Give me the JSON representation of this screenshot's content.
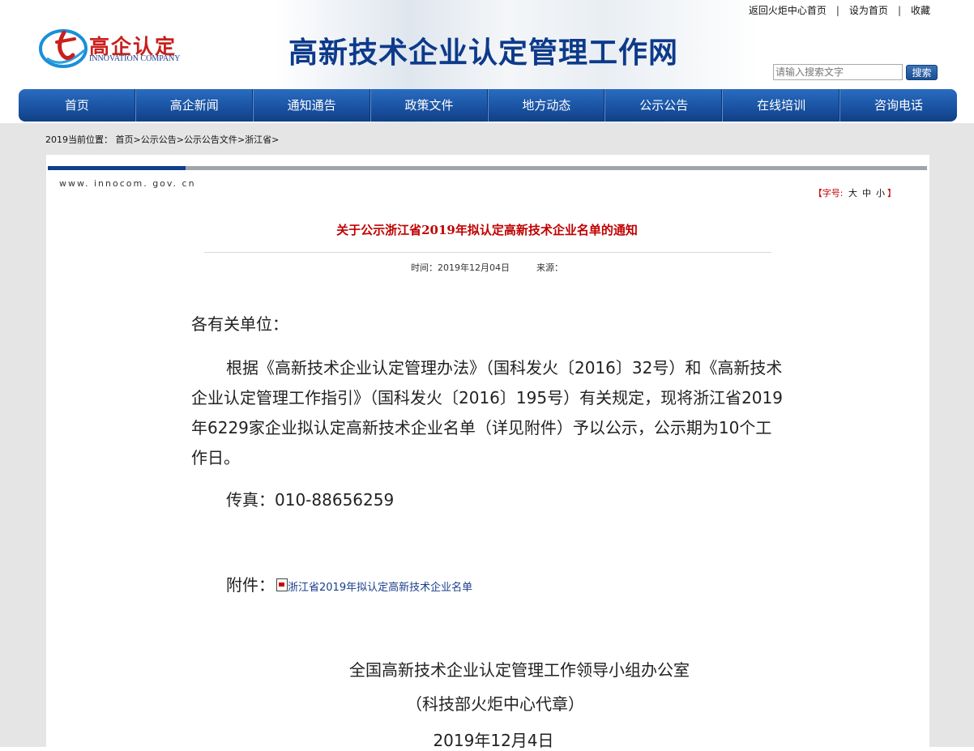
{
  "top_links": {
    "home": "返回火炬中心首页",
    "set_home": "设为首页",
    "bookmark": "收藏",
    "separator": "|"
  },
  "logo": {
    "title": "高企认定",
    "subtitle": "INNOVATION COMPANY",
    "icon": "torch-swirl-logo",
    "colors": {
      "red": "#c8201c",
      "blue": "#1a3e8c"
    }
  },
  "site_title": "高新技术企业认定管理工作网",
  "search": {
    "placeholder": "请输入搜索文字",
    "button": "搜索"
  },
  "nav": [
    "首页",
    "高企新闻",
    "通知通告",
    "政策文件",
    "地方动态",
    "公示公告",
    "在线培训",
    "咨询电话"
  ],
  "breadcrumb": {
    "prefix": "2019当前位置：",
    "items": [
      "首页",
      "公示公告",
      "公示公告文件",
      "浙江省"
    ],
    "sep": ">"
  },
  "site_url": "www. innocom. gov. cn",
  "font_size": {
    "label": "【字号:",
    "large": "大",
    "medium": "中",
    "small": "小",
    "close": "】"
  },
  "article": {
    "title": "关于公示浙江省2019年拟认定高新技术企业名单的通知",
    "time_label": "时间：",
    "time": "2019年12月04日",
    "source_label": "来源：",
    "salutation": "各有关单位：",
    "paragraph": "根据《高新技术企业认定管理办法》（国科发火〔2016〕32号）和《高新技术企业认定管理工作指引》（国科发火〔2016〕195号）有关规定，现将浙江省2019年6229家企业拟认定高新技术企业名单（详见附件）予以公示，公示期为10个工作日。",
    "fax": "传真：010-88656259",
    "attachment_label": "附件：",
    "attachment_link": "浙江省2019年拟认定高新技术企业名单",
    "signature_org": "全国高新技术企业认定管理工作领导小组办公室",
    "signature_seal": "（科技部火炬中心代章）",
    "signature_date": "2019年12月4日"
  },
  "colors": {
    "nav_blue": "#1c56a6",
    "title_blue": "#0d3a8a",
    "article_title_red": "#c00000"
  }
}
